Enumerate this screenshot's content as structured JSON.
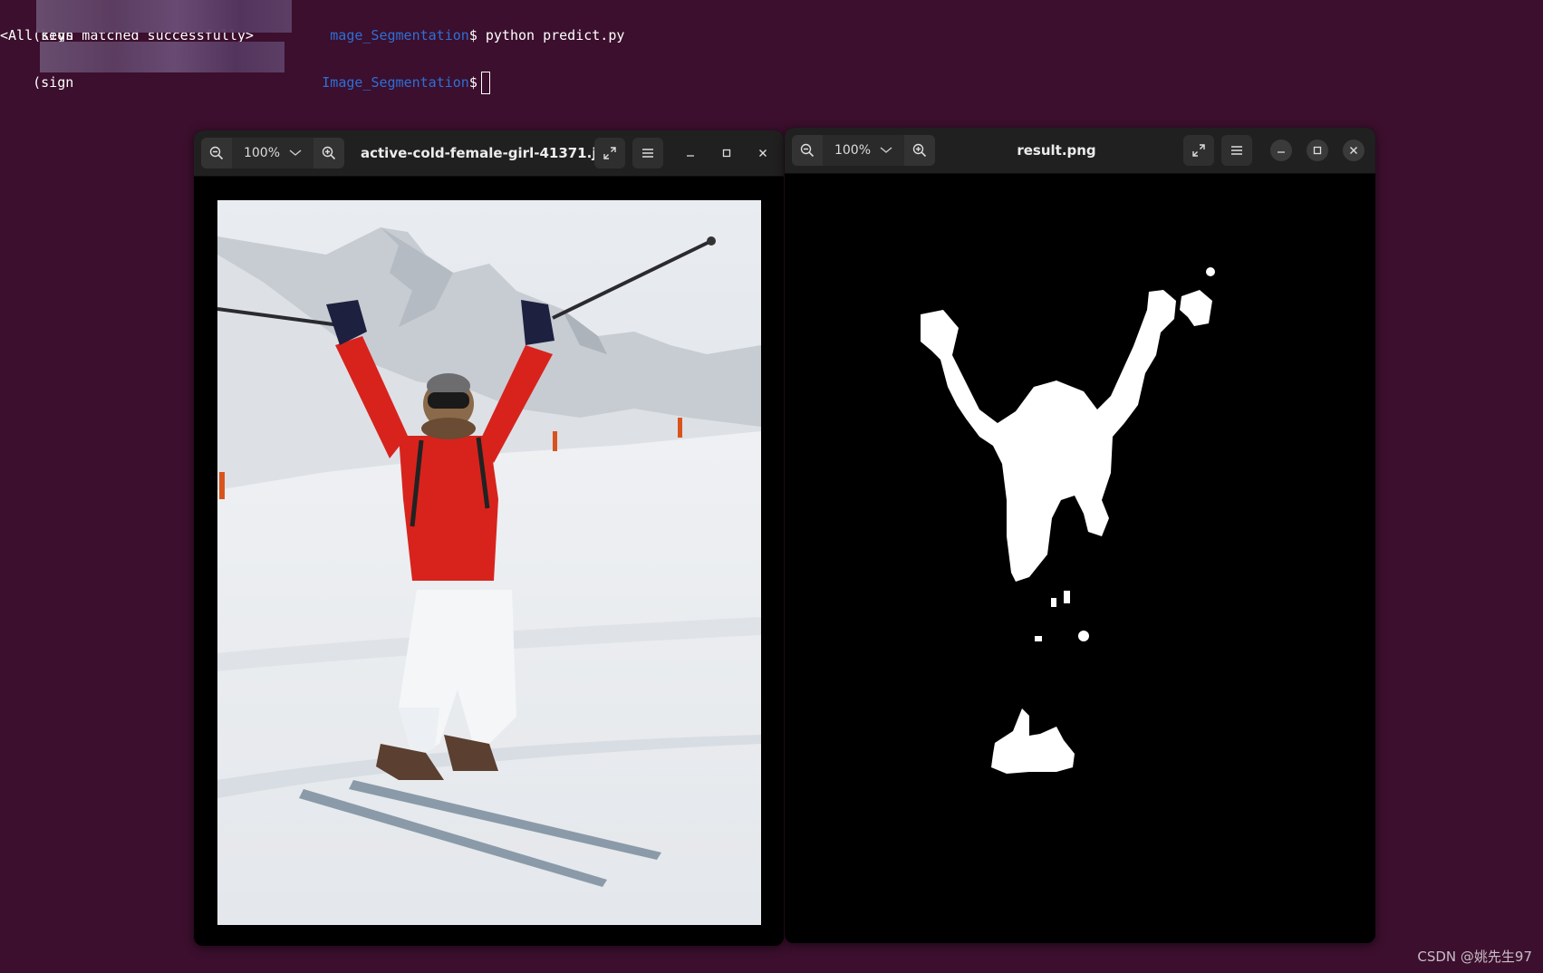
{
  "terminal": {
    "line1_prefix": "(sign",
    "line1_path": "mage_Segmentation",
    "line1_command": "$ python predict.py",
    "line2_output": "<All keys matched successfully>",
    "line3_prefix": "(sign",
    "line3_path": "Image_Segmentation",
    "line3_prompt": "$"
  },
  "viewer_left": {
    "zoom_level": "100%",
    "title": "active-cold-female-girl-41371.jp..."
  },
  "viewer_right": {
    "zoom_level": "100%",
    "title": "result.png"
  },
  "icons": {
    "zoom_out": "zoom-out-icon",
    "zoom_in": "zoom-in-icon",
    "dropdown": "chevron-down-icon",
    "fullscreen": "fullscreen-icon",
    "menu": "hamburger-menu-icon",
    "minimize": "minimize-icon",
    "maximize": "maximize-icon",
    "close": "close-icon"
  },
  "colors": {
    "desktop_bg": "#3b0f2d",
    "terminal_path": "#2e6fd6",
    "titlebar": "#202020"
  },
  "watermark": "CSDN @姚先生97"
}
